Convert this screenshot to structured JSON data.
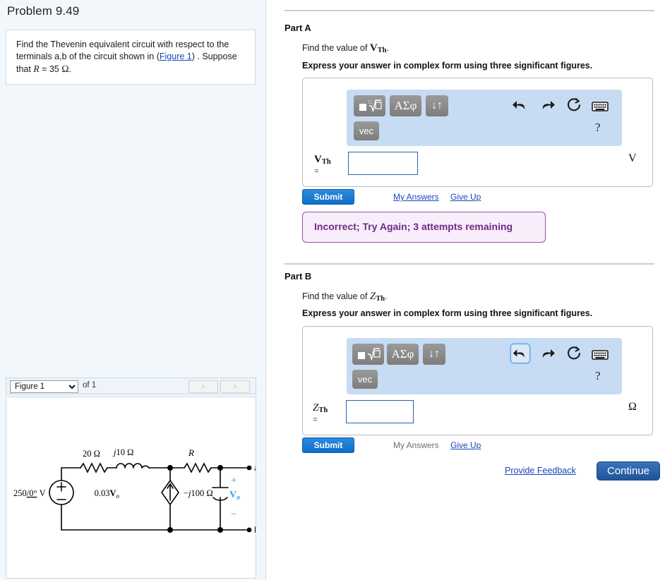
{
  "problem": {
    "title": "Problem 9.49",
    "statement_pre": "Find the Thevenin equivalent circuit with respect to the terminals a,b of the circuit shown in (",
    "figure_link": "Figure 1",
    "statement_mid": ") . Suppose that ",
    "resistor_symbol": "R",
    "resistor_value": "= 35",
    "resistor_unit": "Ω",
    "statement_end": "."
  },
  "figure_bar": {
    "selected_figure": "Figure 1",
    "options": [
      "Figure 1"
    ],
    "of_label": "of 1",
    "prev_icon": "‹",
    "next_icon": "›"
  },
  "circuit": {
    "source_label": "250",
    "source_angle": "0°",
    "source_unit": "V",
    "r1_label": "20 Ω",
    "l1_label": "j10 Ω",
    "dep_source_label": "0.03",
    "dep_source_var": "V",
    "dep_source_sub": "o",
    "cap_label": "−j100 Ω",
    "r_label": "R",
    "node_a": "a",
    "node_b": "b",
    "vo_var": "V",
    "vo_sub": "o",
    "plus_sign": "+",
    "minus_sign": "−",
    "accent_color": "#2ba6e0"
  },
  "mathbar": {
    "template_icon": "square-root-template-icon",
    "greek_label": "ΑΣφ",
    "arrows_label": "↓↑",
    "vec_label": "vec",
    "undo_icon": "undo-icon",
    "redo_icon": "redo-icon",
    "reset_icon": "reset-icon",
    "keyboard_icon": "keyboard-icon",
    "help_label": "?"
  },
  "part_a": {
    "heading": "Part A",
    "question_pre": "Find the value of ",
    "question_symbol": "V",
    "question_sub": "Th",
    "question_end": ".",
    "instruction": "Express your answer in complex form using three significant figures.",
    "answer_label_symbol": "V",
    "answer_label_sub": "Th",
    "equals": "=",
    "answer_value": "",
    "answer_placeholder": "",
    "unit": "V",
    "submit_label": "Submit",
    "my_answers_label": "My Answers",
    "give_up_label": "Give Up",
    "feedback": "Incorrect; Try Again; 3 attempts remaining"
  },
  "part_b": {
    "heading": "Part B",
    "question_pre": "Find the value of ",
    "question_symbol": "Z",
    "question_sub": "Th",
    "question_end": ".",
    "instruction": "Express your answer in complex form using three significant figures.",
    "answer_label_symbol": "Z",
    "answer_label_sub": "Th",
    "equals": "=",
    "answer_value": "",
    "answer_placeholder": "",
    "unit": "Ω",
    "submit_label": "Submit",
    "my_answers_label": "My Answers",
    "give_up_label": "Give Up"
  },
  "footer": {
    "provide_feedback_label": "Provide Feedback",
    "continue_label": "Continue"
  },
  "colors": {
    "accent_blue": "#1577d2",
    "link_blue": "#1a46b8",
    "continue_blue": "#2660a8",
    "mathbar_bg": "#c7dcf2",
    "feedback_border": "#a34ab0",
    "feedback_bg": "#f8eefb",
    "feedback_text": "#6e2a86",
    "circuit_accent": "#2ba6e0"
  }
}
